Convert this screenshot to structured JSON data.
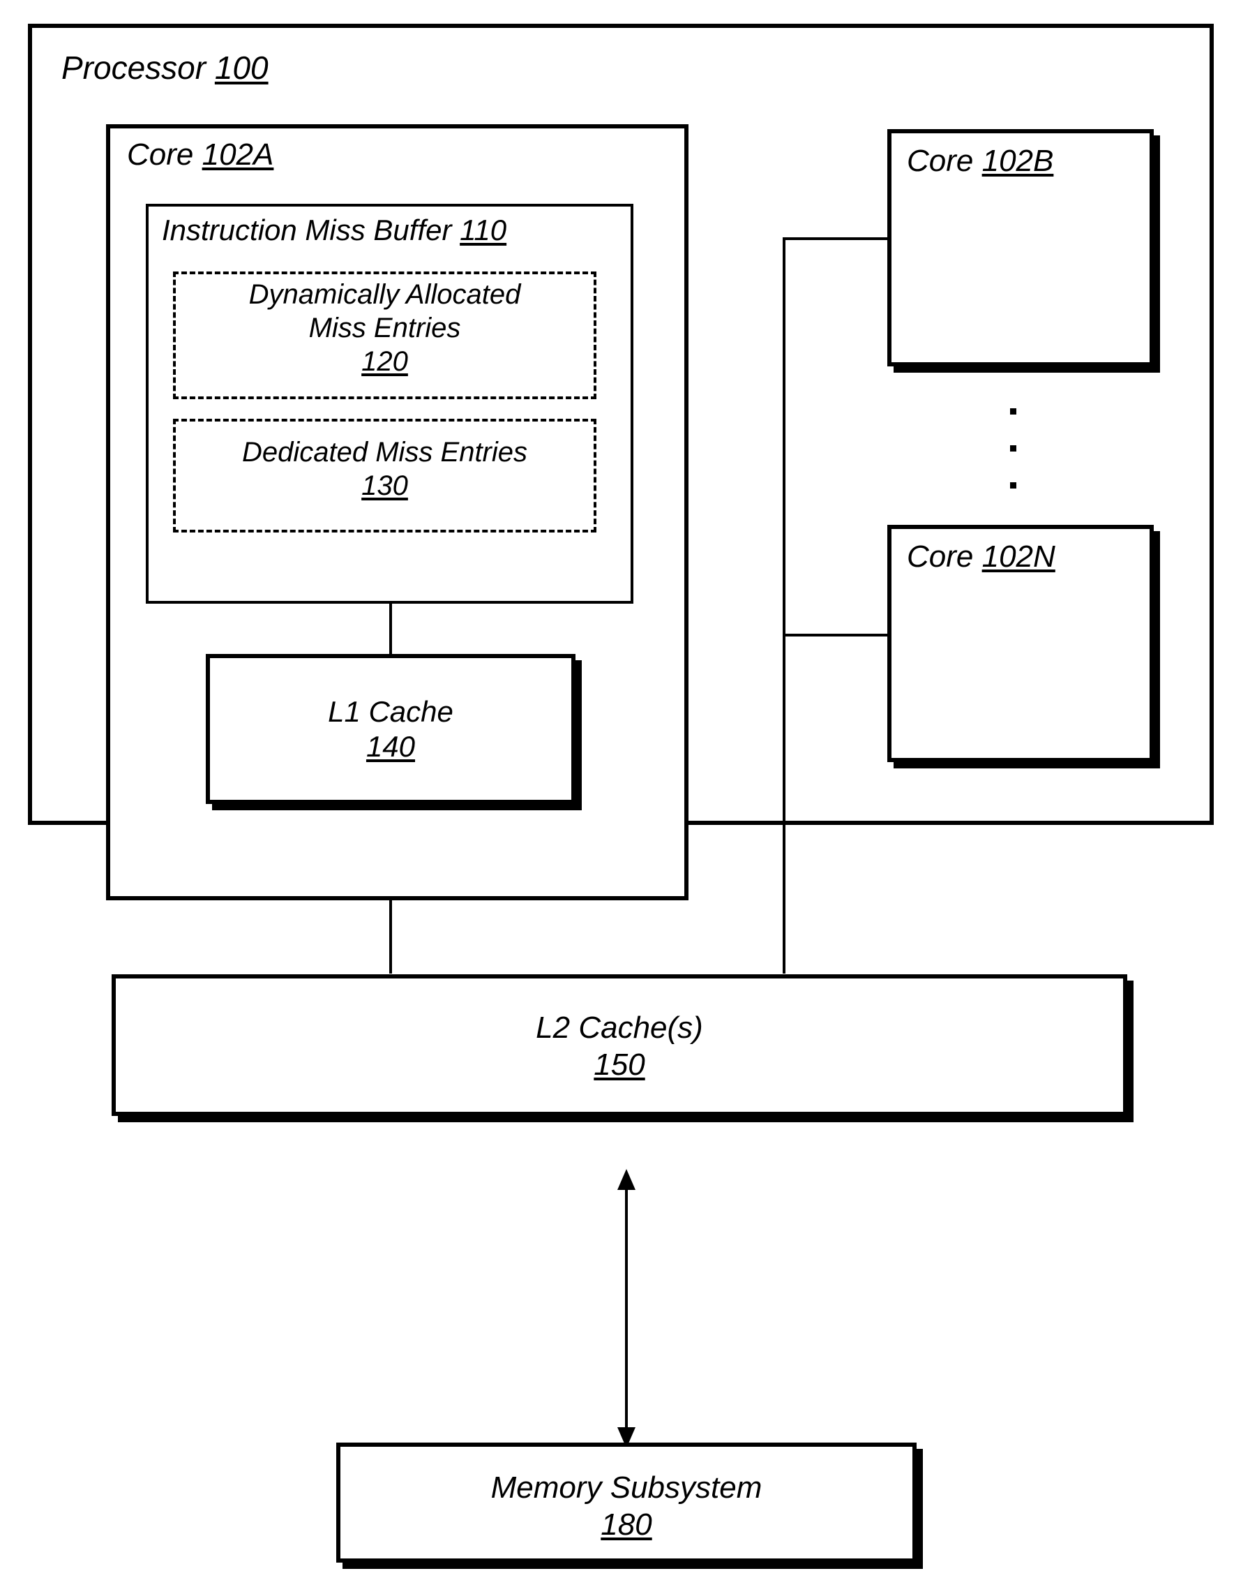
{
  "figure": {
    "processor": {
      "title": "Processor",
      "ref": "100"
    },
    "core_a": {
      "title": "Core",
      "ref": "102A"
    },
    "instruction_miss_buffer": {
      "title": "Instruction Miss Buffer",
      "ref": "110"
    },
    "dynamic_entries": {
      "line1": "Dynamically Allocated",
      "line2": "Miss Entries",
      "ref": "120"
    },
    "dedicated_entries": {
      "line1": "Dedicated Miss Entries",
      "ref": "130"
    },
    "l1_cache": {
      "title": "L1 Cache",
      "ref": "140"
    },
    "core_b": {
      "title": "Core",
      "ref": "102B"
    },
    "core_n": {
      "title": "Core",
      "ref": "102N"
    },
    "ellipsis": "vertical-ellipsis",
    "l2_cache": {
      "title": "L2 Cache(s)",
      "ref": "150"
    },
    "memory_subsystem": {
      "title": "Memory Subsystem",
      "ref": "180"
    }
  },
  "colors": {
    "stroke": "#000000",
    "background": "#ffffff"
  }
}
